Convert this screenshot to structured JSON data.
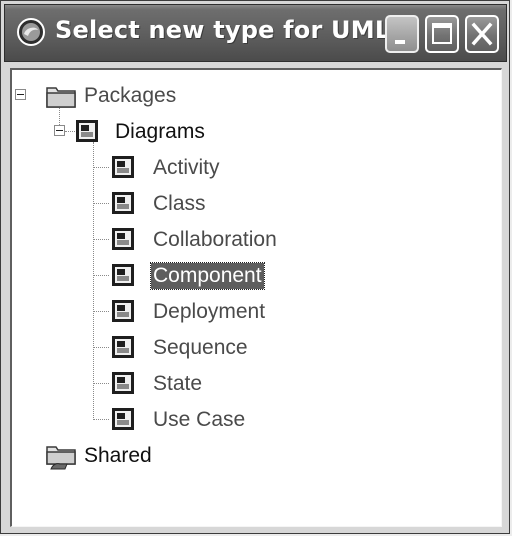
{
  "window": {
    "title": "Select new type for UML"
  },
  "tree": {
    "root": {
      "label": "Packages",
      "expanded": true,
      "icon": "folder-icon"
    },
    "diagrams": {
      "label": "Diagrams",
      "expanded": true,
      "icon": "diagram-icon"
    },
    "children": [
      {
        "label": "Activity",
        "icon": "diagram-icon",
        "selected": false
      },
      {
        "label": "Class",
        "icon": "diagram-icon",
        "selected": false
      },
      {
        "label": "Collaboration",
        "icon": "diagram-icon",
        "selected": false
      },
      {
        "label": "Component",
        "icon": "diagram-icon",
        "selected": true
      },
      {
        "label": "Deployment",
        "icon": "diagram-icon",
        "selected": false
      },
      {
        "label": "Sequence",
        "icon": "diagram-icon",
        "selected": false
      },
      {
        "label": "State",
        "icon": "diagram-icon",
        "selected": false
      },
      {
        "label": "Use Case",
        "icon": "diagram-icon",
        "selected": false
      }
    ],
    "shared": {
      "label": "Shared",
      "icon": "shared-folder-icon"
    }
  }
}
